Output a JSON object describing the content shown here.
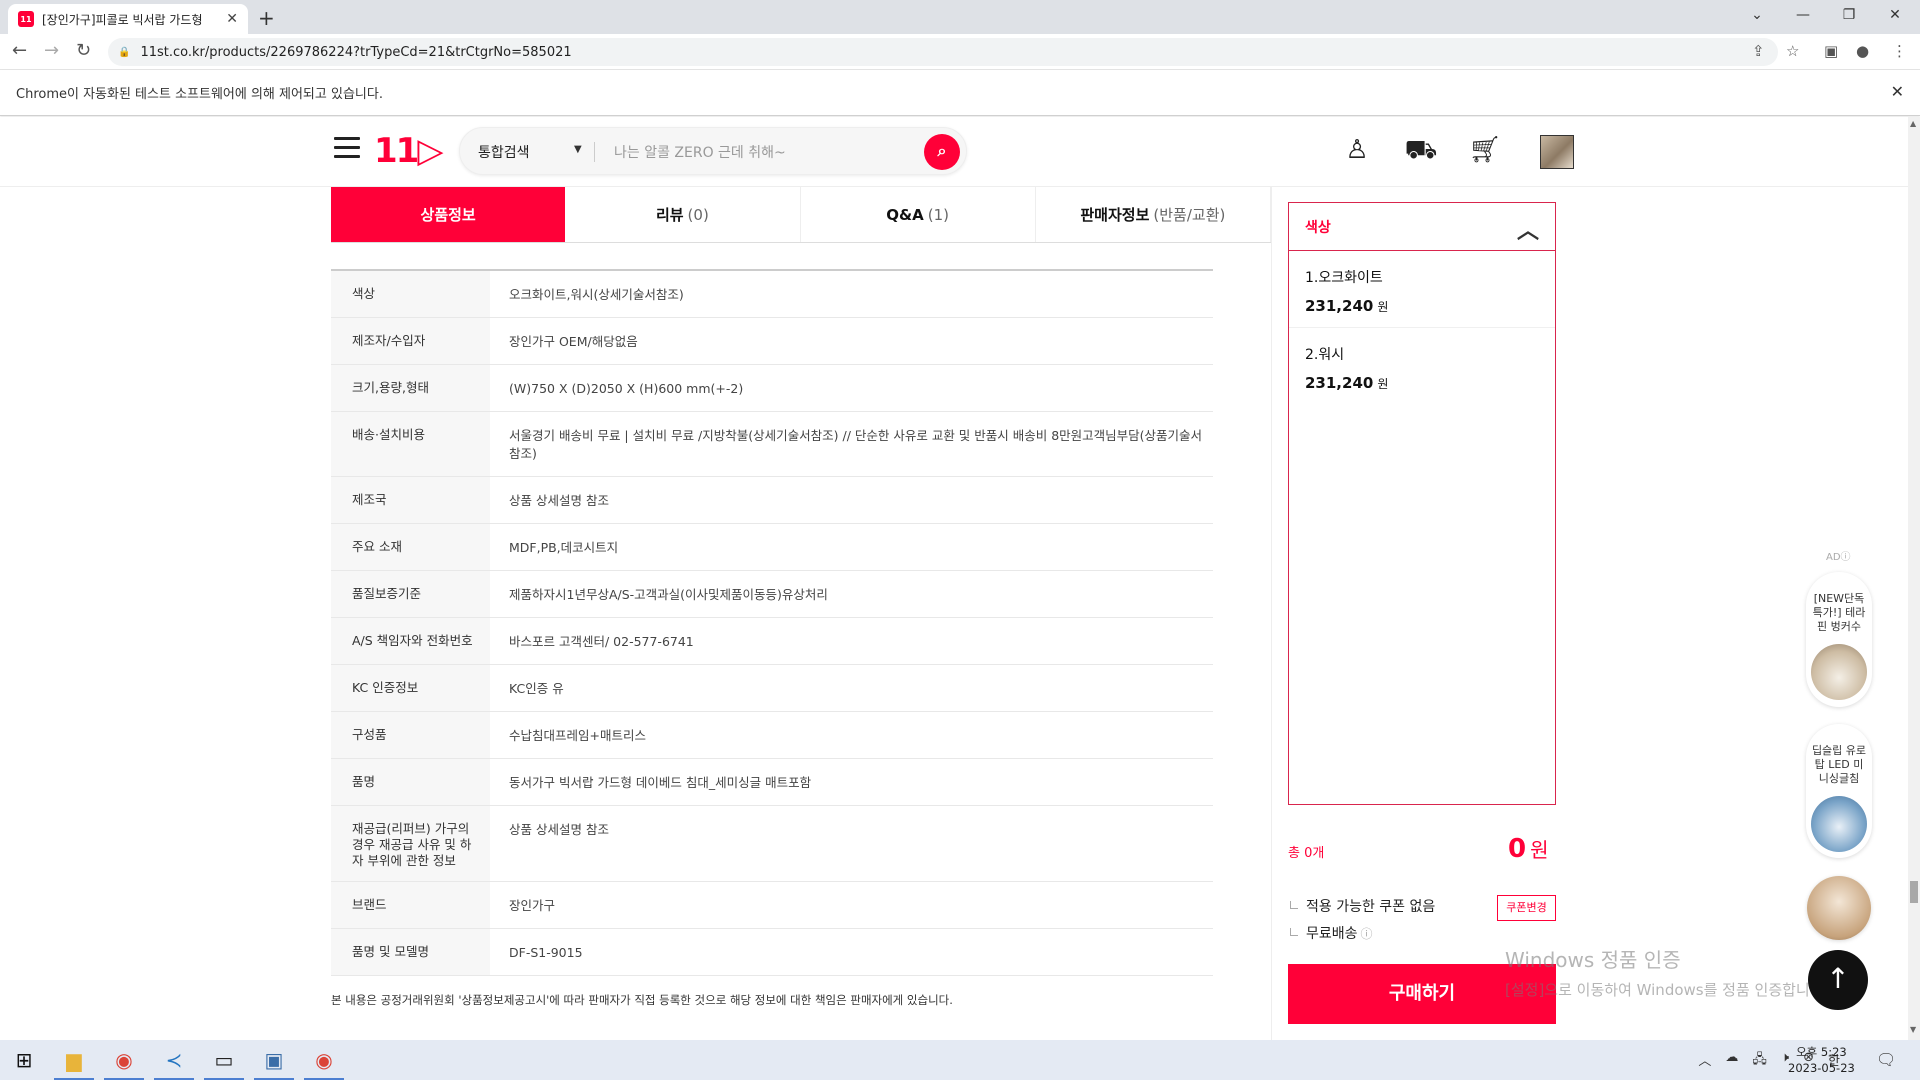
{
  "browser": {
    "tab_title": "[장인가구]피콜로 빅서랍 가드형",
    "favicon_text": "11",
    "url": "11st.co.kr/products/2269786224?trTypeCd=21&trCtgrNo=585021",
    "automation_notice": "Chrome이 자동화된 테스트 소프트웨어에 의해 제어되고 있습니다."
  },
  "header": {
    "logo": "11",
    "search_category": "통합검색",
    "search_placeholder": "나는 알콜 ZERO 근데 취해~"
  },
  "tabs": [
    {
      "label": "상품정보",
      "count": ""
    },
    {
      "label": "리뷰",
      "count": "(0)"
    },
    {
      "label": "Q&A",
      "count": "(1)"
    },
    {
      "label": "판매자정보",
      "count": "(반품/교환)"
    }
  ],
  "info_rows": [
    {
      "key": "색상",
      "value": "오크화이트,워시(상세기술서참조)"
    },
    {
      "key": "제조자/수입자",
      "value": "장인가구 OEM/해당없음"
    },
    {
      "key": "크기,용량,형태",
      "value": "(W)750 X (D)2050 X (H)600 mm(+-2)"
    },
    {
      "key": "배송·설치비용",
      "value": "서울경기 배송비 무료 | 설치비 무료 /지방착불(상세기술서참조) // 단순한 사유로 교환 및 반품시 배송비 8만원고객님부담(상품기술서참조)"
    },
    {
      "key": "제조국",
      "value": "상품 상세설명 참조"
    },
    {
      "key": "주요 소재",
      "value": "MDF,PB,데코시트지"
    },
    {
      "key": "품질보증기준",
      "value": "제품하자시1년무상A/S-고객과실(이사및제품이동등)유상처리"
    },
    {
      "key": "A/S 책임자와 전화번호",
      "value": "바스포르 고객센터/ 02-577-6741"
    },
    {
      "key": "KC 인증정보",
      "value": "KC인증 유"
    },
    {
      "key": "구성품",
      "value": "수납침대프레임+매트리스"
    },
    {
      "key": "품명",
      "value": "동서가구 빅서랍 가드형 데이베드 침대_세미싱글 매트포함"
    },
    {
      "key": "재공급(리퍼브) 가구의 경우 재공급 사유 및 하자 부위에 관한 정보",
      "value": "상품 상세설명 참조"
    },
    {
      "key": "브랜드",
      "value": "장인가구"
    },
    {
      "key": "품명 및 모델명",
      "value": "DF-S1-9015"
    }
  ],
  "notice": "본 내용은 공정거래위원회 '상품정보제공고시'에 따라 판매자가 직접 등록한 것으로 해당 정보에 대한 책임은 판매자에게 있습니다.",
  "option_panel": {
    "title": "색상",
    "options": [
      {
        "name": "1.오크화이트",
        "price": "231,240",
        "unit": "원"
      },
      {
        "name": "2.워시",
        "price": "231,240",
        "unit": "원"
      }
    ]
  },
  "summary": {
    "total_count": "총 0개",
    "total_amount": "0",
    "total_unit": "원",
    "coupon_text": "적용 가능한 쿠폰 없음",
    "coupon_button": "쿠폰변경",
    "shipping_text": "무료배송",
    "buy_button": "구매하기"
  },
  "ads": {
    "label": "AD",
    "items": [
      {
        "text": "[NEW단독특가!] 테라핀 벙커수"
      },
      {
        "text": "딥슬립 유로탑 LED 미니싱글침"
      }
    ]
  },
  "watermark": {
    "line1": "Windows 정품 인증",
    "line2": "[설정]으로 이동하여 Windows를 정품 인증합니다."
  },
  "taskbar": {
    "ime": "한",
    "time": "오후 5:23",
    "date": "2023-05-23"
  },
  "colors": {
    "accent": "#ff0038",
    "panel_border": "#d9254d"
  }
}
